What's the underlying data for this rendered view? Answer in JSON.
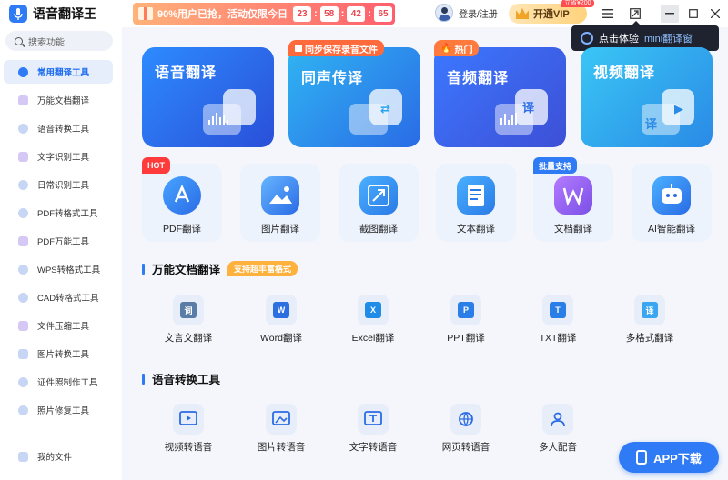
{
  "app": {
    "title": "语音翻译王"
  },
  "promo": {
    "text": "90%用户已抢，活动仅限今日",
    "timer": [
      "23",
      "58",
      "42",
      "65"
    ]
  },
  "user": {
    "login": "登录/注册"
  },
  "vip": {
    "label": "开通VIP",
    "tag": "立省¥200"
  },
  "tooltip": {
    "text": "点击体验",
    "accent": "mini翻译窗"
  },
  "search": {
    "placeholder": "搜索功能"
  },
  "sidebar": {
    "items": [
      {
        "label": "常用翻译工具",
        "active": true
      },
      {
        "label": "万能文档翻译"
      },
      {
        "label": "语音转换工具"
      },
      {
        "label": "文字识别工具"
      },
      {
        "label": "日常识别工具"
      },
      {
        "label": "PDF转格式工具"
      },
      {
        "label": "PDF万能工具"
      },
      {
        "label": "WPS转格式工具"
      },
      {
        "label": "CAD转格式工具"
      },
      {
        "label": "文件压缩工具"
      },
      {
        "label": "图片转换工具"
      },
      {
        "label": "证件照制作工具"
      },
      {
        "label": "照片修复工具"
      }
    ],
    "my_files": "我的文件"
  },
  "big_cards": [
    {
      "title": "语音翻译",
      "tag": ""
    },
    {
      "title": "同声传译",
      "tag": "同步保存录音文件"
    },
    {
      "title": "音频翻译",
      "tag": "热门"
    },
    {
      "title": "视频翻译",
      "tag": ""
    }
  ],
  "small_cards": [
    {
      "label": "PDF翻译",
      "tag": "HOT"
    },
    {
      "label": "图片翻译",
      "tag": ""
    },
    {
      "label": "截图翻译",
      "tag": ""
    },
    {
      "label": "文本翻译",
      "tag": ""
    },
    {
      "label": "文档翻译",
      "tag": "批量支持"
    },
    {
      "label": "AI智能翻译",
      "tag": ""
    }
  ],
  "section_doc": {
    "title": "万能文档翻译",
    "badge": "支持超丰富格式",
    "tools": [
      {
        "label": "文言文翻译",
        "glyph": "词"
      },
      {
        "label": "Word翻译",
        "glyph": "W"
      },
      {
        "label": "Excel翻译",
        "glyph": "X"
      },
      {
        "label": "PPT翻译",
        "glyph": "P"
      },
      {
        "label": "TXT翻译",
        "glyph": "T"
      },
      {
        "label": "多格式翻译",
        "glyph": "译"
      }
    ]
  },
  "section_voice": {
    "title": "语音转换工具",
    "tools": [
      {
        "label": "视频转语音"
      },
      {
        "label": "图片转语音"
      },
      {
        "label": "文字转语音"
      },
      {
        "label": "网页转语音"
      },
      {
        "label": "多人配音"
      }
    ]
  },
  "app_download": "APP下载",
  "colors": {
    "accent": "#2f7bf5",
    "hot": "#ff4d4f",
    "orange": "#ffb13d"
  }
}
